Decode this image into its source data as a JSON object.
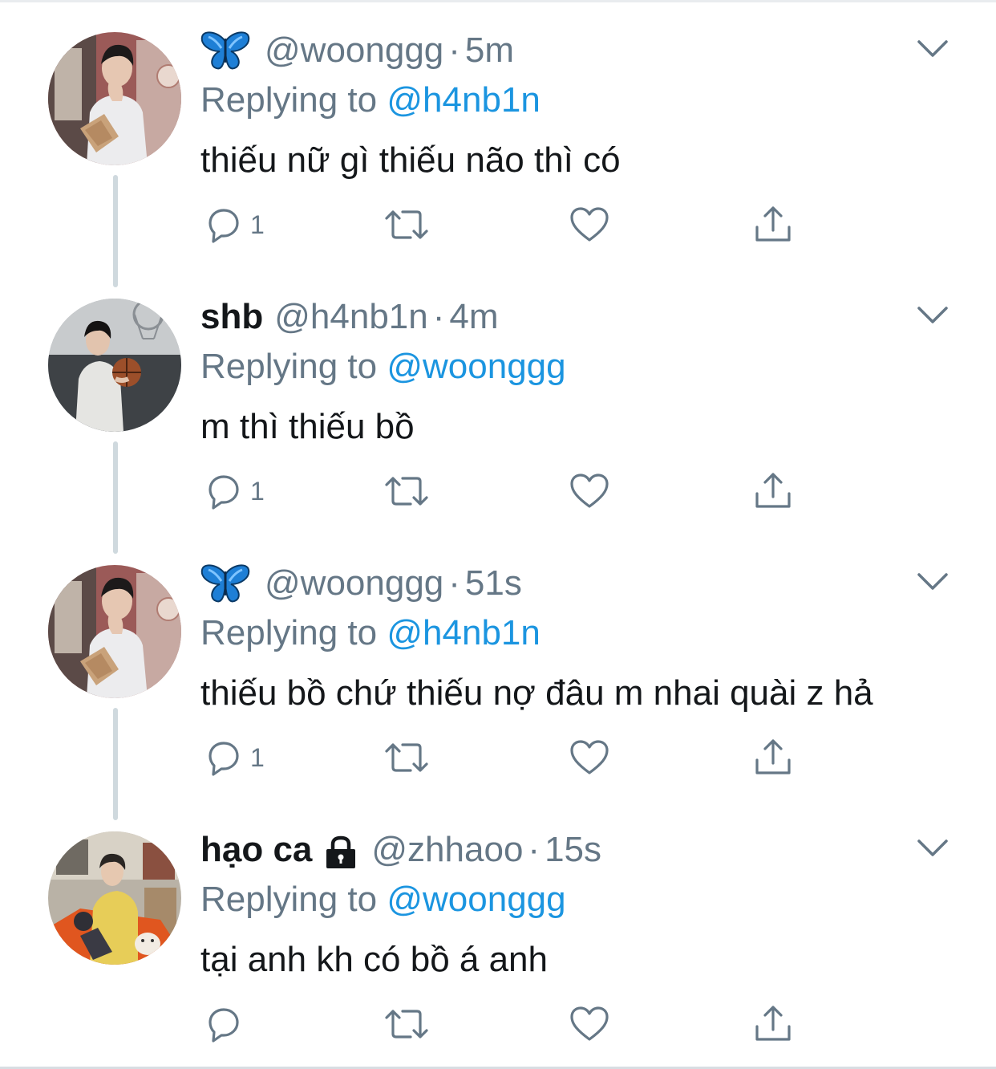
{
  "colors": {
    "text_primary": "#14171a",
    "text_secondary": "#657786",
    "link": "#1b95e0",
    "thread_line": "#cfd9de"
  },
  "tweets": [
    {
      "avatar": "avatar-woonggg",
      "display_name": "",
      "name_icon": "butterfly-icon",
      "handle": "@woonggg",
      "separator": "·",
      "time": "5m",
      "replying_prefix": "Replying to ",
      "replying_to": "@h4nb1n",
      "text": "thiếu nữ gì thiếu não thì có",
      "reply_count": "1"
    },
    {
      "avatar": "avatar-h4nb1n",
      "display_name": "shb",
      "handle": "@h4nb1n",
      "separator": "·",
      "time": "4m",
      "replying_prefix": "Replying to ",
      "replying_to": "@woonggg",
      "text": "m thì thiếu bồ",
      "reply_count": "1"
    },
    {
      "avatar": "avatar-woonggg",
      "display_name": "",
      "name_icon": "butterfly-icon",
      "handle": "@woonggg",
      "separator": "·",
      "time": "51s",
      "replying_prefix": "Replying to ",
      "replying_to": "@h4nb1n",
      "text": "thiếu bồ chứ thiếu nợ đâu m nhai quài z hả",
      "reply_count": "1"
    },
    {
      "avatar": "avatar-zhhaoo",
      "display_name": "hạo ca",
      "name_icon": "lock-icon",
      "handle": "@zhhaoo",
      "separator": "·",
      "time": "15s",
      "replying_prefix": "Replying to ",
      "replying_to": "@woonggg",
      "text": "tại anh kh có bồ á anh",
      "reply_count": ""
    }
  ]
}
